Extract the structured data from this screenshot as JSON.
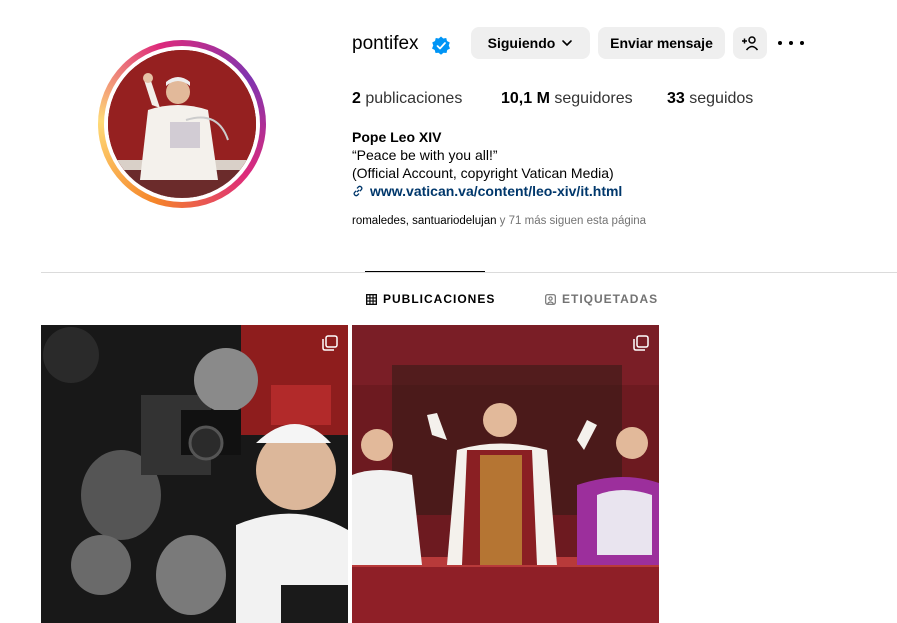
{
  "profile": {
    "username": "pontifex",
    "verified_color": "#0095f6",
    "buttons": {
      "following": "Siguiendo",
      "message": "Enviar mensaje"
    },
    "stats": {
      "posts_count": "2",
      "posts_label": "publicaciones",
      "followers_count": "10,1 M",
      "followers_label": "seguidores",
      "following_count": "33",
      "following_label": "seguidos"
    },
    "bio": {
      "name": "Pope Leo XIV",
      "line1": "“Peace be with you all!”",
      "line2": "(Official Account, copyright Vatican Media)",
      "link": "www.vatican.va/content/leo-xiv/it.html"
    },
    "followed_by": {
      "names": "romaledes, santuariodelujan",
      "rest": " y 71 más siguen esta página"
    }
  },
  "tabs": {
    "posts": "PUBLICACIONES",
    "tagged": "ETIQUETADAS"
  },
  "posts": [
    {
      "type": "carousel",
      "description": "photo"
    },
    {
      "type": "carousel",
      "description": "photo"
    }
  ],
  "icons": {
    "verified": "verified-badge-icon",
    "chevron": "chevron-down-icon",
    "add_person": "add-person-icon",
    "more": "more-icon",
    "link": "link-icon",
    "grid": "grid-icon",
    "tagged": "tagged-icon",
    "carousel": "carousel-icon"
  }
}
